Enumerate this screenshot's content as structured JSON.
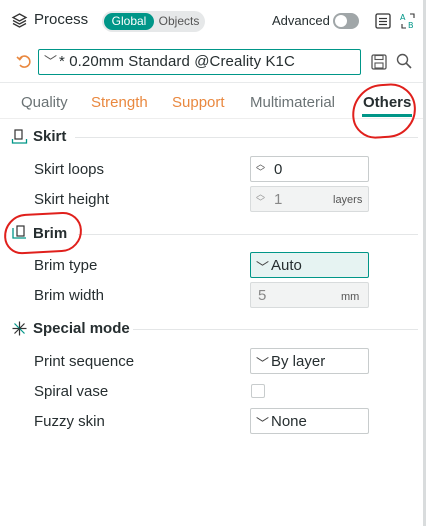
{
  "header": {
    "title": "Process",
    "segment": {
      "global": "Global",
      "objects": "Objects"
    },
    "advanced_label": "Advanced"
  },
  "preset": {
    "value": "* 0.20mm Standard @Creality K1C"
  },
  "tabs": [
    {
      "label": "Quality",
      "color": "#6b7375"
    },
    {
      "label": "Strength",
      "color": "#e9883f"
    },
    {
      "label": "Support",
      "color": "#e9883f"
    },
    {
      "label": "Multimaterial",
      "color": "#6b7375"
    },
    {
      "label": "Others",
      "color": "#262e30",
      "active": true
    }
  ],
  "sections": {
    "skirt": {
      "title": "Skirt",
      "icon": "skirt-icon",
      "rows": {
        "loops": {
          "label": "Skirt loops",
          "value": "0"
        },
        "height": {
          "label": "Skirt height",
          "value": "1",
          "unit": "layers"
        }
      }
    },
    "brim": {
      "title": "Brim",
      "icon": "brim-icon",
      "rows": {
        "type": {
          "label": "Brim type",
          "value": "Auto"
        },
        "width": {
          "label": "Brim width",
          "value": "5",
          "unit": "mm"
        }
      }
    },
    "special": {
      "title": "Special mode",
      "icon": "special-mode-icon",
      "rows": {
        "sequence": {
          "label": "Print sequence",
          "value": "By layer"
        },
        "spiral": {
          "label": "Spiral vase",
          "checked": false
        },
        "fuzzy": {
          "label": "Fuzzy skin",
          "value": "None"
        }
      }
    }
  },
  "colors": {
    "accent": "#009688",
    "annotation": "#e0201c",
    "orange_tab": "#e9883f"
  }
}
